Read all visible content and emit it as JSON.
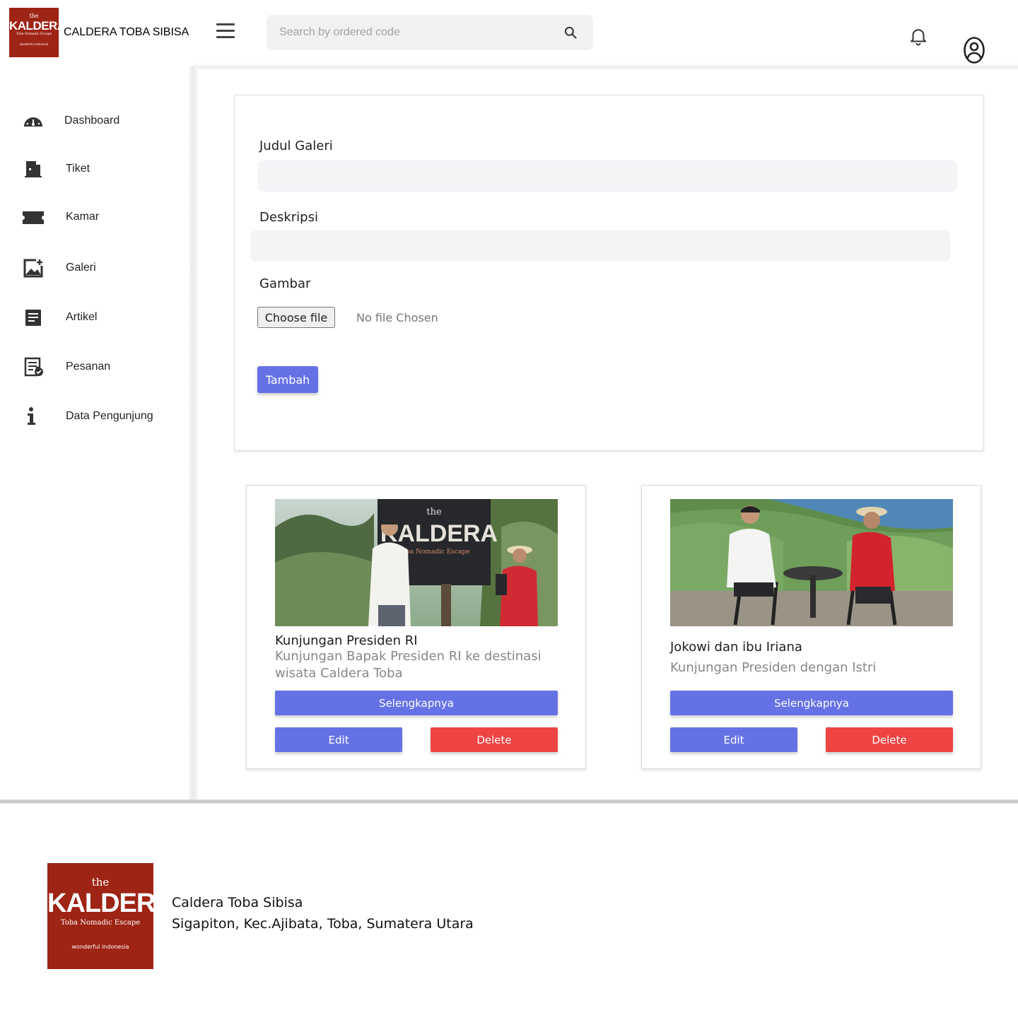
{
  "header": {
    "logo": {
      "the": "the",
      "name": "KALDERA",
      "tagline": "Toba Nomadic Escape",
      "partner": "wonderful indonesia"
    },
    "app_title": "CALDERA TOBA SIBISA",
    "search_placeholder": "Search by ordered code",
    "icons": [
      "menu-icon",
      "search-icon",
      "bell-icon",
      "user-icon"
    ]
  },
  "sidebar": {
    "items": [
      {
        "label": "Dashboard",
        "icon": "dashboard-icon"
      },
      {
        "label": "Tiket",
        "icon": "door-icon"
      },
      {
        "label": "Kamar",
        "icon": "ticket-icon"
      },
      {
        "label": "Galeri",
        "icon": "gallery-icon"
      },
      {
        "label": "Artikel",
        "icon": "article-icon"
      },
      {
        "label": "Pesanan",
        "icon": "order-icon"
      },
      {
        "label": "Data Pengunjung",
        "icon": "info-icon"
      }
    ]
  },
  "form": {
    "title_label": "Judul Galeri",
    "title_value": "",
    "desc_label": "Deskripsi",
    "desc_value": "",
    "image_label": "Gambar",
    "choose_file": "Choose file",
    "no_file": "No file Chosen",
    "submit": "Tambah"
  },
  "gallery": [
    {
      "title": "Kunjungan Presiden RI",
      "description": "Kunjungan Bapak Presiden RI ke destinasi wisata Caldera Toba",
      "photo_sign": {
        "the": "the",
        "name": "KALDERA",
        "tagline": "Toba Nomadic Escape"
      },
      "more": "Selengkapnya",
      "edit": "Edit",
      "delete": "Delete"
    },
    {
      "title": "Jokowi dan ibu Iriana",
      "description": "Kunjungan Presiden dengan Istri",
      "more": "Selengkapnya",
      "edit": "Edit",
      "delete": "Delete"
    }
  ],
  "footer": {
    "logo": {
      "the": "the",
      "name": "KALDERA",
      "tagline": "Toba Nomadic Escape",
      "partner": "wonderful indonesia"
    },
    "name": "Caldera Toba Sibisa",
    "address": "Sigapiton, Kec.Ajibata, Toba, Sumatera Utara"
  },
  "colors": {
    "brand_red": "#9e2416",
    "primary_button": "#6572e6",
    "danger_button": "#ef4444"
  }
}
